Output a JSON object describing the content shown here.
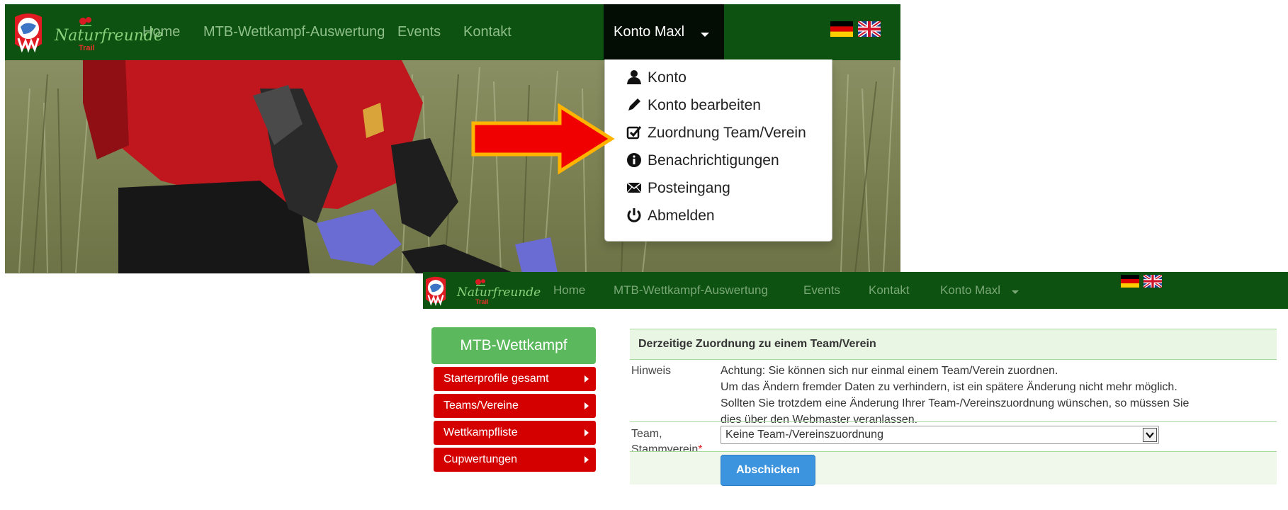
{
  "top": {
    "nav": {
      "brand": "Naturfreunde",
      "brand_sub": "Trail",
      "items": [
        "Home",
        "MTB-Wettkampf-Auswertung",
        "Events",
        "Kontakt"
      ],
      "account_label": "Konto Maxl"
    },
    "dropdown": [
      {
        "label": "Konto",
        "icon": "user-icon"
      },
      {
        "label": "Konto bearbeiten",
        "icon": "pencil-icon"
      },
      {
        "label": "Zuordnung Team/Verein",
        "icon": "check-square-icon"
      },
      {
        "label": "Benachrichtigungen",
        "icon": "info-icon"
      },
      {
        "label": "Posteingang",
        "icon": "envelope-icon"
      },
      {
        "label": "Abmelden",
        "icon": "power-icon"
      }
    ]
  },
  "bottom": {
    "nav": {
      "brand": "Naturfreunde",
      "brand_sub": "Trail",
      "items": [
        "Home",
        "MTB-Wettkampf-Auswertung",
        "Events",
        "Kontakt"
      ],
      "account_label": "Konto Maxl"
    },
    "sidebar": {
      "title": "MTB-Wettkampf",
      "items": [
        "Starterprofile gesamt",
        "Teams/Vereine",
        "Wettkampfliste",
        "Cupwertungen"
      ]
    },
    "panel": {
      "heading": "Derzeitige Zuordnung zu einem Team/Verein",
      "hint_label": "Hinweis",
      "hint_lines": [
        "Achtung: Sie können sich nur einmal einem Team/Verein zuordnen.",
        "Um das Ändern fremder Daten zu verhindern, ist ein spätere Änderung nicht mehr möglich.",
        "Sollten Sie trotzdem eine Änderung Ihrer Team-/Vereinszuordnung wünschen, so müssen Sie",
        "dies über den Webmaster veranlassen."
      ],
      "team_label_1": "Team,",
      "team_label_2": "Stammverein",
      "required_mark": "*",
      "select_value": "Keine Team-/Vereinszuordnung",
      "submit_label": "Abschicken"
    }
  },
  "colors": {
    "nav_green": "#0d5210",
    "sidebar_green": "#5cb85c",
    "sidebar_red": "#d40000",
    "submit_blue": "#3d94de",
    "arrow_red": "#f00000",
    "arrow_outline": "#ffb400"
  }
}
